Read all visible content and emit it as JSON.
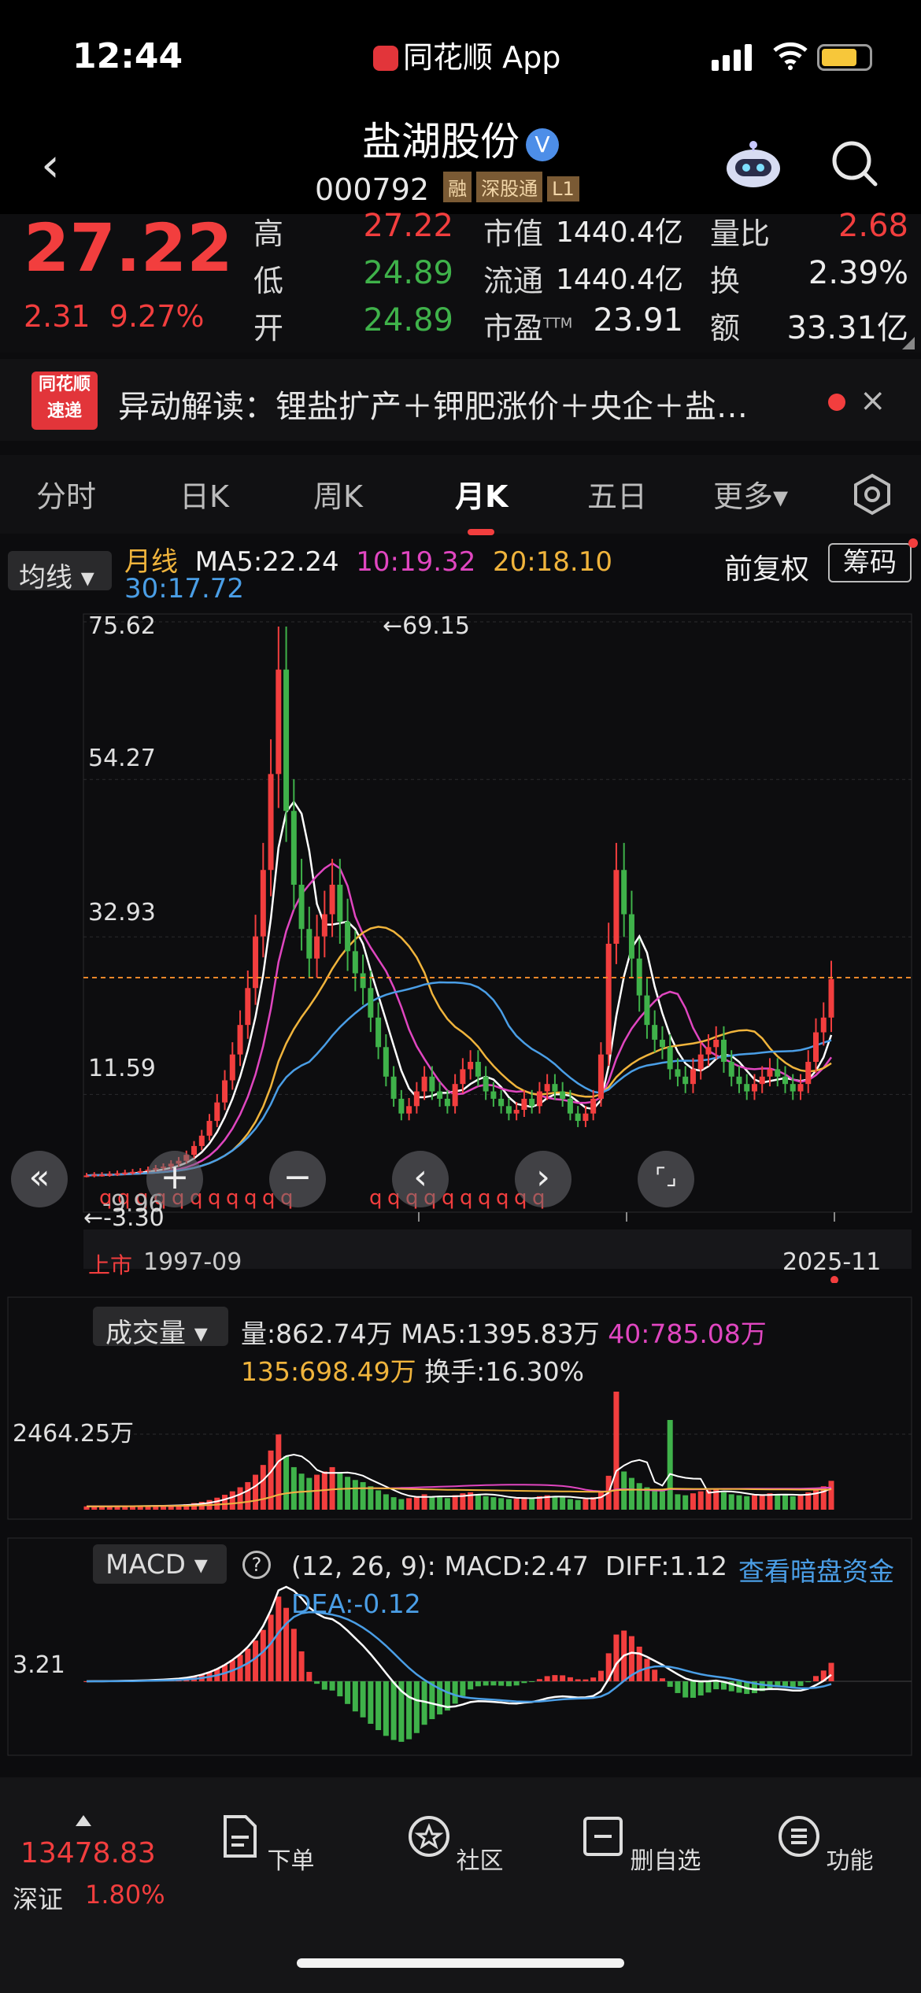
{
  "status_bar": {
    "time": "12:44",
    "app": "同花顺 App"
  },
  "header": {
    "title": "盐湖股份",
    "verified": "V",
    "code": "000792",
    "tags": [
      "融",
      "深股通",
      "L1"
    ]
  },
  "quote": {
    "price": "27.22",
    "change": "2.31",
    "change_pct": "9.27%",
    "rows": [
      {
        "l1": "高",
        "v1": "27.22",
        "l2": "市值",
        "v2": "1440.4亿",
        "l3": "量比",
        "v3": "2.68"
      },
      {
        "l1": "低",
        "v1": "24.89",
        "l2": "流通",
        "v2": "1440.4亿",
        "l3": "换",
        "v3": "2.39%"
      },
      {
        "l1": "开",
        "v1": "24.89",
        "l2": "市盈",
        "l2sup": "TTM",
        "v2": "23.91",
        "l3": "额",
        "v3": "33.31亿"
      }
    ]
  },
  "alert": {
    "logo_top": "同花顺",
    "logo_bottom": "速递",
    "text": "异动解读：锂盐扩产＋钾肥涨价＋央企＋盐…",
    "close": "×"
  },
  "tabs": [
    "分时",
    "日K",
    "周K",
    "月K",
    "五日",
    "更多▾"
  ],
  "active_tab": "月K",
  "indicator": {
    "selector": "均线 ▾",
    "period": "月线",
    "ma5": "MA5:22.24",
    "ma10": "10:19.32",
    "ma20": "20:18.10",
    "ma30": "30:17.72",
    "fuquan": "前复权",
    "chouma": "筹码"
  },
  "kline": {
    "y_labels": [
      "75.62",
      "54.27",
      "32.93",
      "11.59"
    ],
    "high_label": "←69.15",
    "low_label": "←-3.30",
    "low_tick": "-9.96",
    "listing_tag": "上市",
    "start_date": "1997-09",
    "end_date": "2025-11",
    "current_price": 27.22,
    "controls": [
      "«",
      "+",
      "−",
      "‹",
      "›",
      "⌜⌟"
    ]
  },
  "volume": {
    "selector": "成交量 ▾",
    "vol": "量:862.74万",
    "ma5": "MA5:1395.83万",
    "ma40": "40:785.08万",
    "ma135": "135:698.49万",
    "turnover": "换手:16.30%",
    "y_label": "2464.25万"
  },
  "macd": {
    "selector": "MACD ▾",
    "help": "?",
    "params": "(12, 26, 9):",
    "macd": "MACD:2.47",
    "diff": "DIFF:1.12",
    "link": "查看暗盘资金",
    "dea": "DEA:-0.12",
    "y_label": "3.21"
  },
  "bottom_nav": {
    "index_value": "13478.83",
    "index_name": "深证",
    "index_pct": "1.80%",
    "items": [
      "下单",
      "社区",
      "删自选",
      "功能"
    ]
  },
  "colors": {
    "up": "#f23e3e",
    "down": "#3fb24a",
    "ma5": "#ffffff",
    "ma10": "#e046c0",
    "ma20": "#f0b43c",
    "ma30": "#4a9ee6"
  },
  "chart_data": {
    "type": "line",
    "title": "",
    "xlabel": "",
    "ylabel": "",
    "x": [
      "1997-09",
      "2025-11"
    ],
    "ylim": [
      -3.3,
      75.62
    ],
    "series": [
      {
        "name": "MA5",
        "values": [
          22.24
        ]
      },
      {
        "name": "10",
        "values": [
          19.32
        ]
      },
      {
        "name": "20",
        "values": [
          18.1
        ]
      },
      {
        "name": "30",
        "values": [
          17.72
        ]
      }
    ],
    "close_path": [
      0.6,
      0.7,
      0.7,
      0.8,
      0.9,
      1,
      1.1,
      1.2,
      1.4,
      1.6,
      1.8,
      2.2,
      2.6,
      3.4,
      4.6,
      6,
      8,
      10.5,
      13.5,
      17,
      21,
      26,
      33,
      42,
      55,
      69.15,
      50,
      40,
      34,
      30,
      33,
      36,
      40,
      35,
      31,
      28,
      26,
      22,
      18,
      14,
      11,
      9,
      10,
      12,
      14,
      12,
      11,
      10,
      13,
      15,
      16,
      14,
      12,
      11,
      10,
      9,
      9.5,
      11,
      10,
      12,
      13,
      12,
      11,
      9,
      8,
      9,
      11,
      17,
      32,
      42,
      36,
      30,
      25,
      21,
      19,
      18,
      15,
      14,
      13,
      15,
      17,
      18,
      19,
      16,
      14,
      13,
      12,
      13,
      14,
      15,
      14,
      13,
      12,
      13,
      16,
      20,
      22,
      27.22
    ]
  }
}
